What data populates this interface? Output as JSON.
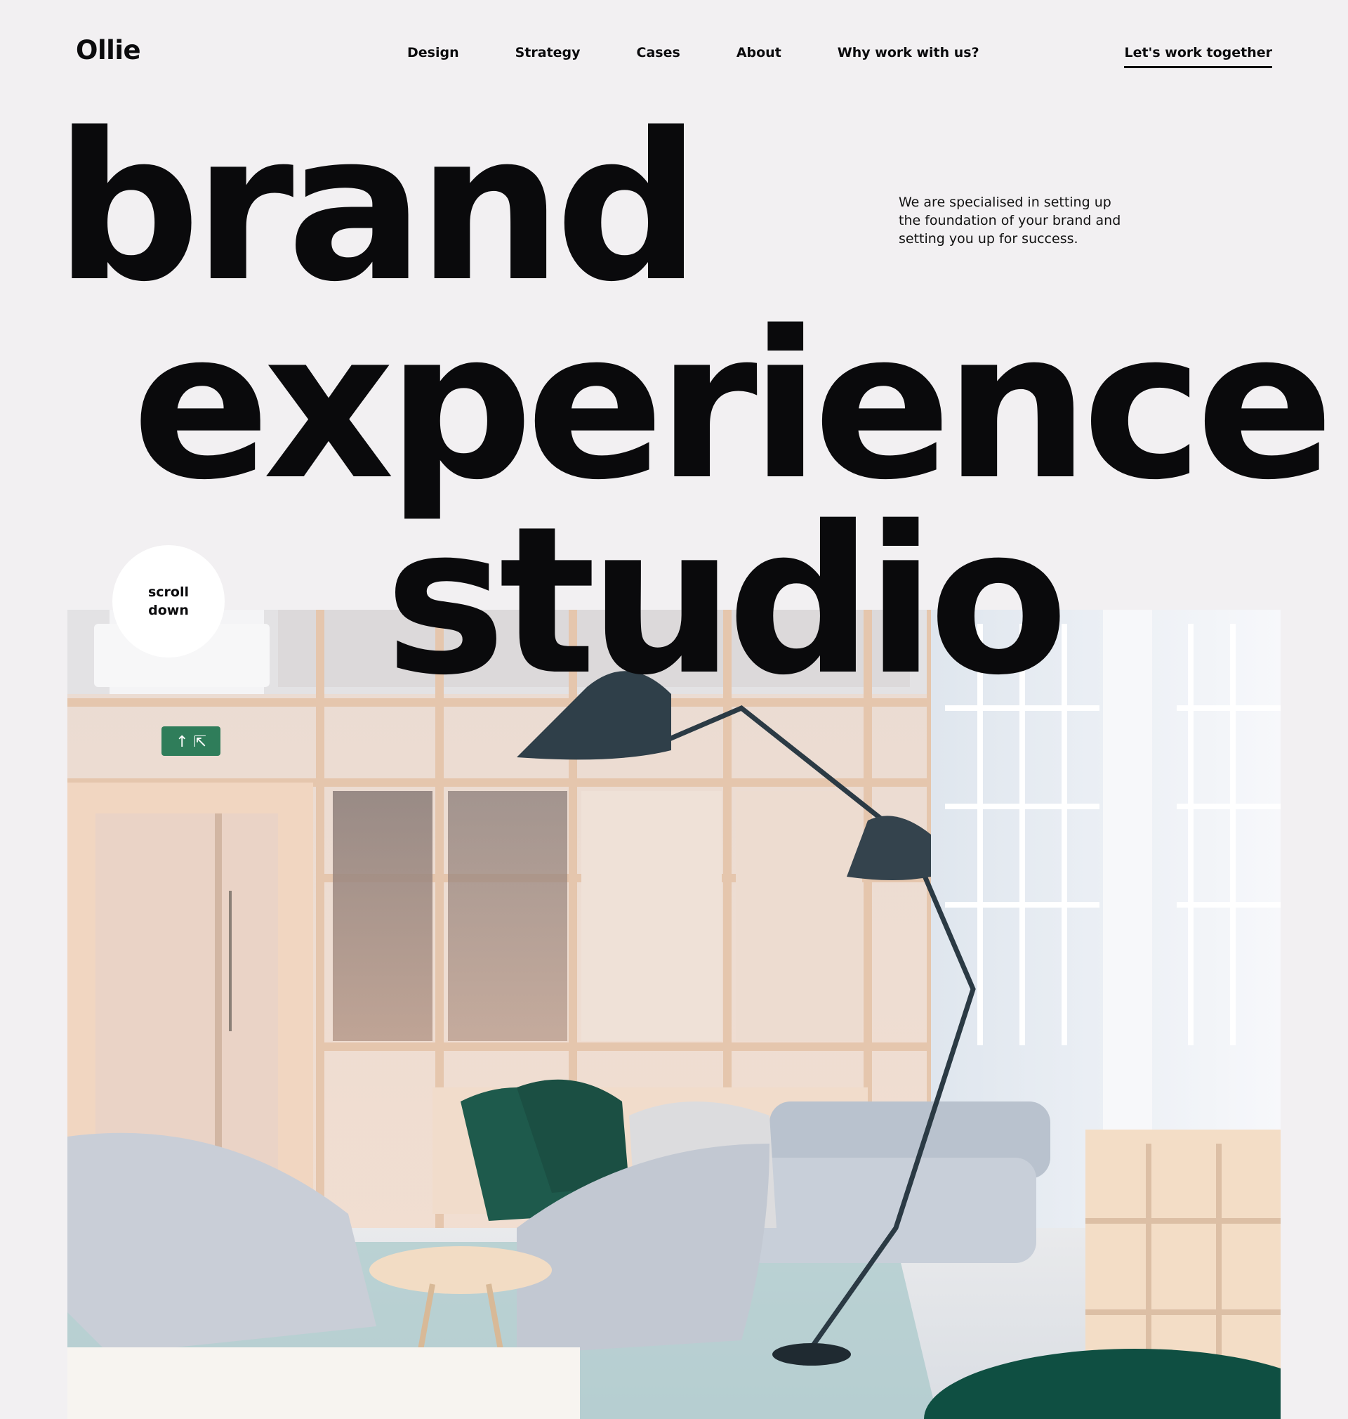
{
  "brand": {
    "logo": "Ollie"
  },
  "nav": {
    "items": [
      {
        "label": "Design"
      },
      {
        "label": "Strategy"
      },
      {
        "label": "Cases"
      },
      {
        "label": "About"
      },
      {
        "label": "Why work with us?"
      }
    ],
    "cta_label": "Let's work together"
  },
  "hero": {
    "headline_lines": [
      "brand",
      "experience",
      "studio"
    ],
    "intro": "We are specialised in setting up the foundation of your brand and setting you up for success.",
    "scroll_line_1": "scroll",
    "scroll_line_2": "down"
  },
  "image": {
    "description_icon": "office-interior-photo",
    "palette": {
      "background": "#f2f0f2",
      "wood": "#f0d3bd",
      "green": "#1e5a4c",
      "grey_fabric": "#c9cfd9",
      "lamp": "#2b3a44"
    }
  }
}
